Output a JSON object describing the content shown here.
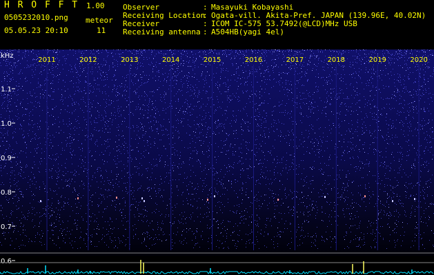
{
  "header": {
    "app_title": "H R O F F T",
    "app_version": "1.00",
    "filename": "0505232010.png",
    "timestamp": "05.05.23 20:10",
    "meteor_label": "meteor",
    "meteor_count": "11"
  },
  "info": [
    {
      "key": "Observer",
      "value": "Masayuki Kobayashi"
    },
    {
      "key": "Receiving Location",
      "value": "Ogata-vill. Akita-Pref. JAPAN (139.96E, 40.02N)"
    },
    {
      "key": "Receiver",
      "value": "ICOM IC-575 53.7492(@LCD)MHz USB"
    },
    {
      "key": "Receiving antenna",
      "value": "A504HB(yagi 4el)"
    }
  ],
  "chart_data": {
    "type": "heatmap",
    "ylabel": "kHz",
    "x_ticks": [
      "2011",
      "2012",
      "2013",
      "2014",
      "2015",
      "2016",
      "2017",
      "2018",
      "2019",
      "2020"
    ],
    "y_ticks": [
      "1.1",
      "1.0",
      "0.9",
      "0.8",
      "0.7",
      "0.6"
    ],
    "colors": {
      "background": "#000010",
      "noise": "#3030c0",
      "speckle": "#8080ff",
      "tick": "#ffff00",
      "trace": "#00e0ff"
    }
  }
}
